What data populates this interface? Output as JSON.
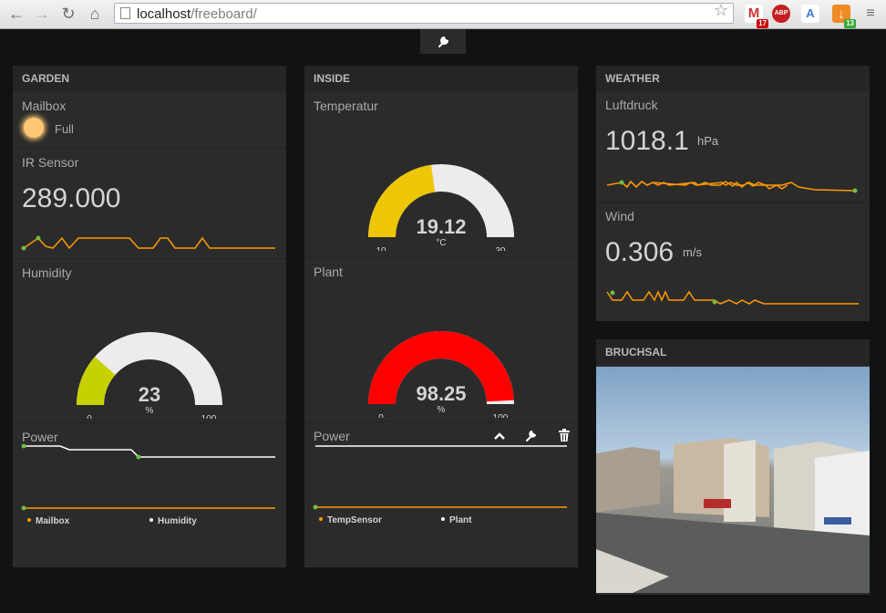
{
  "browser": {
    "url_host": "localhost",
    "url_path": "/freeboard/",
    "ext_gmail_count": "17",
    "ext_abp": "ABP",
    "ext_green_count": "13"
  },
  "panes": {
    "garden": {
      "title": "GARDEN",
      "mailbox": {
        "label": "Mailbox",
        "status": "Full",
        "indicator_color": "#ffc773"
      },
      "ir_sensor": {
        "label": "IR Sensor",
        "value": "289.000"
      },
      "humidity": {
        "label": "Humidity",
        "value": "23",
        "unit": "%",
        "min": "0",
        "max": "100",
        "level": 0.23,
        "color": "#c7d100"
      },
      "power": {
        "label": "Power",
        "legend": [
          {
            "name": "Mailbox",
            "color": "#ff9900"
          },
          {
            "name": "Humidity",
            "color": "#ffffff"
          }
        ]
      }
    },
    "inside": {
      "title": "INSIDE",
      "temperatur": {
        "label": "Temperatur",
        "value": "19.12",
        "unit": "°C",
        "min": "10",
        "max": "30",
        "level": 0.456,
        "color": "#edc705"
      },
      "plant": {
        "label": "Plant",
        "value": "98.25",
        "unit": "%",
        "min": "0",
        "max": "100",
        "level": 0.9825,
        "color": "#ff0000"
      },
      "power": {
        "label": "Power",
        "legend": [
          {
            "name": "TempSensor",
            "color": "#ff9900"
          },
          {
            "name": "Plant",
            "color": "#ffffff"
          }
        ]
      }
    },
    "weather": {
      "title": "WEATHER",
      "luftdruck": {
        "label": "Luftdruck",
        "value": "1018.1",
        "unit": "hPa"
      },
      "wind": {
        "label": "Wind",
        "value": "0.306",
        "unit": "m/s"
      }
    },
    "bruchsal": {
      "title": "BRUCHSAL"
    }
  },
  "colors": {
    "background": "#101214",
    "pane": "#2b2b2b",
    "sparkline": "#ff9900",
    "gauge_track": "#edebeb",
    "point": "#6ebd43"
  }
}
